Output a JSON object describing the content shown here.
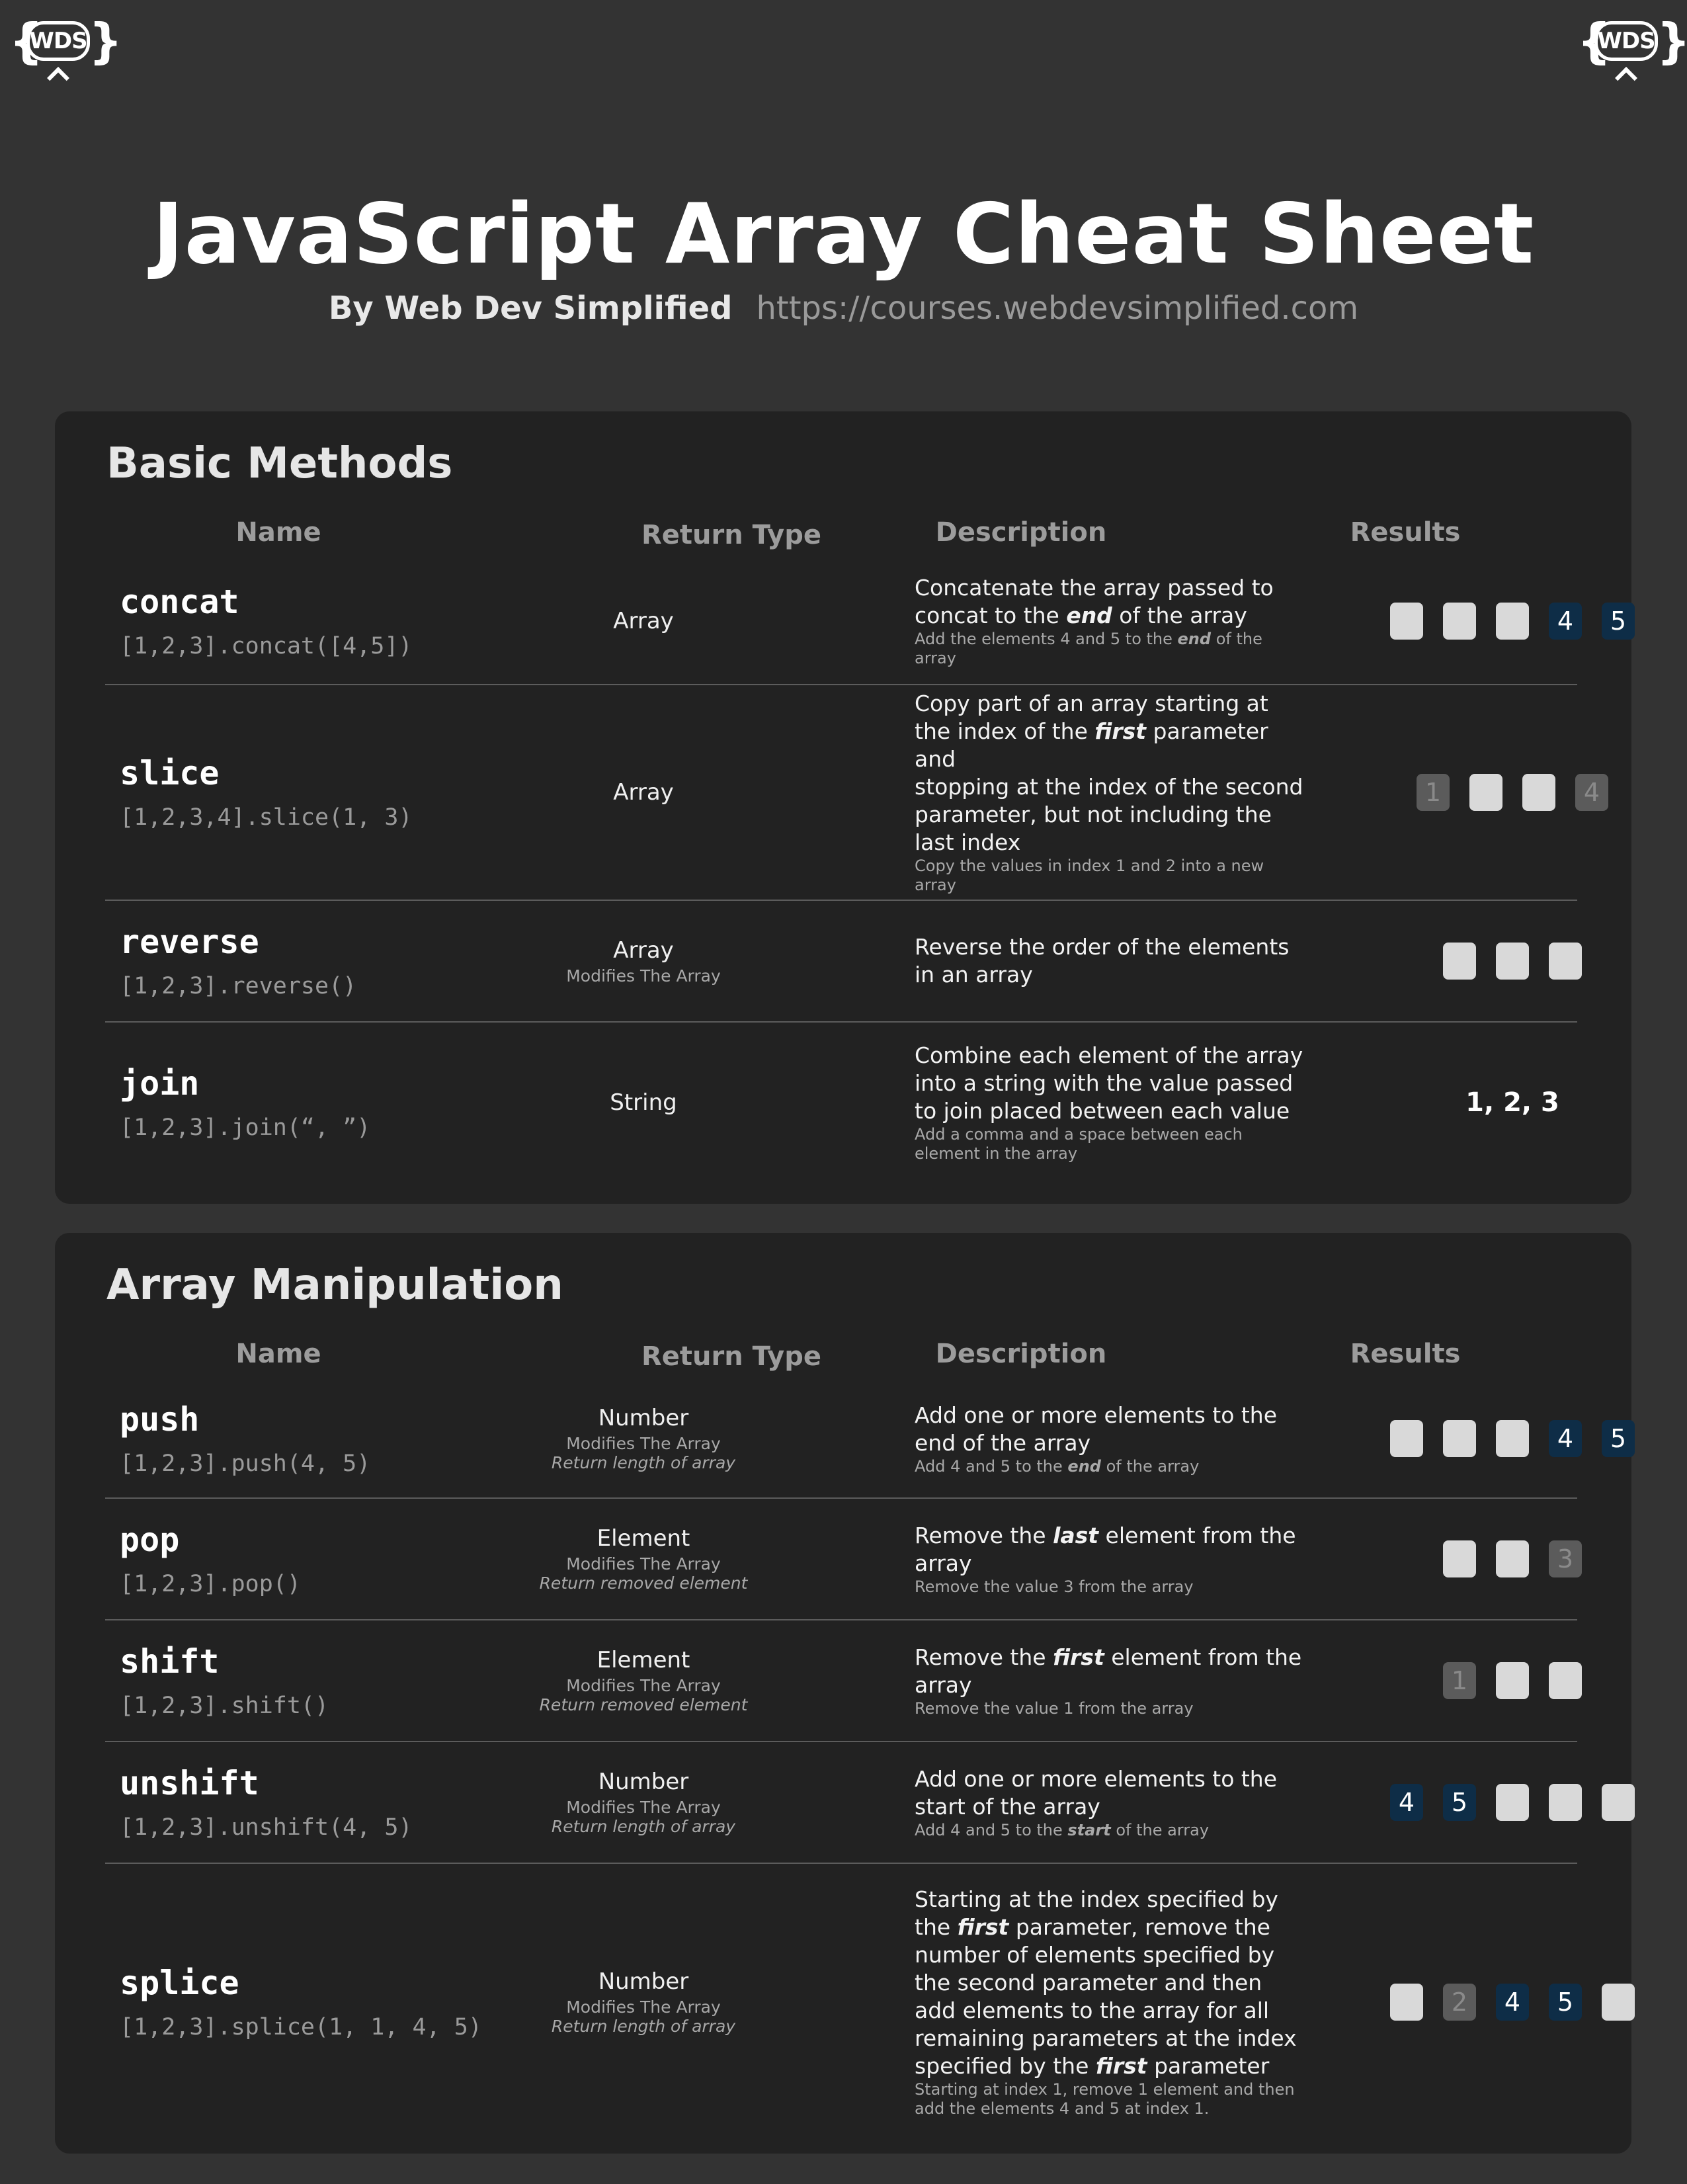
{
  "logo_text": "WDS",
  "title": "JavaScript Array Cheat Sheet",
  "byline": "By Web Dev Simplified",
  "url": "https://courses.webdevsimplified.com",
  "columns": {
    "name": "Name",
    "return_type": "Return Type",
    "description": "Description",
    "results": "Results"
  },
  "colors": {
    "background": "#333333",
    "panel": "#222222",
    "result_white": "#d9d9d9",
    "result_new": "#0e2d47",
    "result_removed": "#5b5b5b"
  },
  "sections": [
    {
      "title": "Basic Methods",
      "rows": [
        {
          "method": "concat",
          "example": "[1,2,3].concat([4,5])",
          "return_type": "Array",
          "modifies": "",
          "returns": "",
          "desc": [
            "Concatenate the array passed to",
            "concat to the end of the array"
          ],
          "note": [
            "Add the elements 4 and 5 to the end of the",
            "array"
          ],
          "results": [
            {
              "t": "w",
              "v": ""
            },
            {
              "t": "w",
              "v": ""
            },
            {
              "t": "w",
              "v": ""
            },
            {
              "t": "b",
              "v": "4"
            },
            {
              "t": "b",
              "v": "5"
            }
          ]
        },
        {
          "method": "slice",
          "example": "[1,2,3,4].slice(1, 3)",
          "return_type": "Array",
          "modifies": "",
          "returns": "",
          "desc": [
            "Copy part of an array starting at",
            "the index of the first parameter and",
            "stopping at the index of the second",
            "parameter, but not including the",
            "last index"
          ],
          "note": [
            "Copy the values in index 1 and 2 into a new",
            "array"
          ],
          "results": [
            {
              "t": "g",
              "v": "1"
            },
            {
              "t": "w",
              "v": ""
            },
            {
              "t": "w",
              "v": ""
            },
            {
              "t": "g",
              "v": "4"
            }
          ]
        },
        {
          "method": "reverse",
          "example": "[1,2,3].reverse()",
          "return_type": "Array",
          "modifies": "Modifies The Array",
          "returns": "",
          "desc": [
            "Reverse the order of the elements",
            "in an array"
          ],
          "note": [],
          "results": [
            {
              "t": "w",
              "v": ""
            },
            {
              "t": "w",
              "v": ""
            },
            {
              "t": "w",
              "v": ""
            }
          ]
        },
        {
          "method": "join",
          "example": "[1,2,3].join(“, ”)",
          "return_type": "String",
          "modifies": "",
          "returns": "",
          "desc": [
            "Combine each element of the array",
            "into a string with the value passed",
            "to join placed between each value"
          ],
          "note": [
            "Add a comma and a space between each",
            "element in the array"
          ],
          "result_text": "1, 2, 3",
          "results": []
        }
      ]
    },
    {
      "title": "Array Manipulation",
      "rows": [
        {
          "method": "push",
          "example": "[1,2,3].push(4, 5)",
          "return_type": "Number",
          "modifies": "Modifies The Array",
          "returns": "Return length of array",
          "desc": [
            "Add one or more elements to the",
            "end of the array"
          ],
          "note": [
            "Add 4 and 5 to the end of the array"
          ],
          "results": [
            {
              "t": "w",
              "v": ""
            },
            {
              "t": "w",
              "v": ""
            },
            {
              "t": "w",
              "v": ""
            },
            {
              "t": "b",
              "v": "4"
            },
            {
              "t": "b",
              "v": "5"
            }
          ]
        },
        {
          "method": "pop",
          "example": "[1,2,3].pop()",
          "return_type": "Element",
          "modifies": "Modifies The Array",
          "returns": "Return removed element",
          "desc": [
            "Remove the last element from the",
            "array"
          ],
          "note": [
            "Remove the value 3 from the array"
          ],
          "results": [
            {
              "t": "w",
              "v": ""
            },
            {
              "t": "w",
              "v": ""
            },
            {
              "t": "g",
              "v": "3"
            }
          ]
        },
        {
          "method": "shift",
          "example": "[1,2,3].shift()",
          "return_type": "Element",
          "modifies": "Modifies The Array",
          "returns": "Return removed element",
          "desc": [
            "Remove the first element from the",
            "array"
          ],
          "note": [
            "Remove the value 1 from the array"
          ],
          "results": [
            {
              "t": "g",
              "v": "1"
            },
            {
              "t": "w",
              "v": ""
            },
            {
              "t": "w",
              "v": ""
            }
          ]
        },
        {
          "method": "unshift",
          "example": "[1,2,3].unshift(4, 5)",
          "return_type": "Number",
          "modifies": "Modifies The Array",
          "returns": "Return length of array",
          "desc": [
            "Add one or more elements to the",
            "start of the array"
          ],
          "note": [
            "Add 4 and 5 to the start of the array"
          ],
          "results": [
            {
              "t": "b",
              "v": "4"
            },
            {
              "t": "b",
              "v": "5"
            },
            {
              "t": "w",
              "v": ""
            },
            {
              "t": "w",
              "v": ""
            },
            {
              "t": "w",
              "v": ""
            }
          ]
        },
        {
          "method": "splice",
          "example": "[1,2,3].splice(1, 1, 4, 5)",
          "return_type": "Number",
          "modifies": "Modifies The Array",
          "returns": "Return length of array",
          "desc": [
            "Starting at the index specified by",
            "the first parameter, remove the",
            "number of elements specified by",
            "the second parameter and then",
            "add elements to the array for all",
            "remaining parameters at the index",
            "specified by the first parameter"
          ],
          "note": [
            "Starting at index 1, remove 1 element and then",
            "add the elements 4 and 5 at index 1."
          ],
          "results": [
            {
              "t": "w",
              "v": ""
            },
            {
              "t": "g",
              "v": "2"
            },
            {
              "t": "b",
              "v": "4"
            },
            {
              "t": "b",
              "v": "5"
            },
            {
              "t": "w",
              "v": ""
            }
          ]
        }
      ]
    }
  ]
}
